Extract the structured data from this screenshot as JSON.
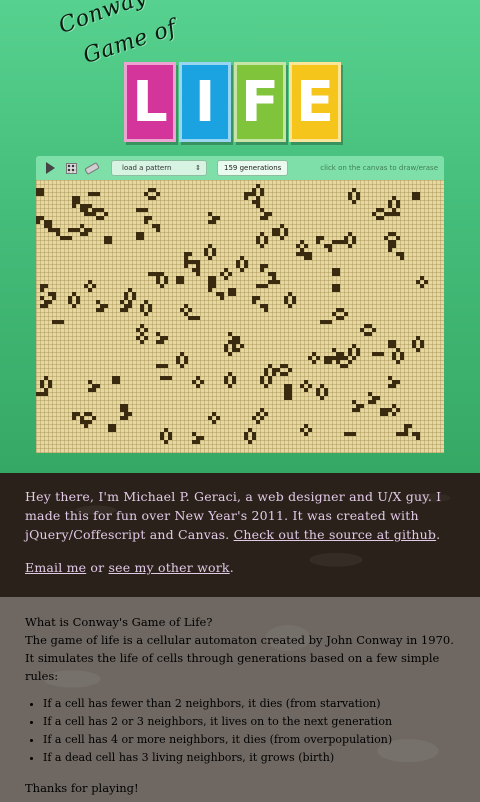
{
  "header": {
    "title_line1": "Conway's",
    "title_line2": "Game of",
    "tiles": [
      {
        "letter": "L",
        "color": "#d4359a"
      },
      {
        "letter": "I",
        "color": "#1aa3e0"
      },
      {
        "letter": "F",
        "color": "#7fc43a"
      },
      {
        "letter": "E",
        "color": "#f5c51c"
      }
    ]
  },
  "toolbar": {
    "play_icon": "play-icon",
    "random_icon": "dice-icon",
    "erase_icon": "eraser-icon",
    "pattern_select": "load a pattern",
    "generations": "159 generations",
    "hint": "click on the canvas to draw/erase"
  },
  "board": {
    "cell_color": "#3a2a10",
    "grid_color": "#e6d8a0"
  },
  "about": {
    "intro": "Hey there, I'm Michael P. Geraci, a web designer and U/X guy. I made this for fun over New Year's 2011. It was created with jQuery/Coffescript and Canvas. ",
    "source_link": "Check out the source at github",
    "intro_end": ".",
    "email_link": "Email me",
    "or_text": " or ",
    "work_link": "see my other work",
    "contact_end": "."
  },
  "rules": {
    "heading": "What is Conway's Game of Life?",
    "description": "The game of life is a cellular automaton created by John Conway in 1970. It simulates the life of cells through generations based on a few simple rules:",
    "items": [
      "If a cell has fewer than 2 neighbors, it dies (from starvation)",
      "If a cell has 2 or 3 neighbors, it lives on to the next generation",
      "If a cell has 4 or more neighbors, it dies (from overpopulation)",
      "If a dead cell has 3 living neighbors, it grows (birth)"
    ],
    "thanks": "Thanks for playing!"
  }
}
